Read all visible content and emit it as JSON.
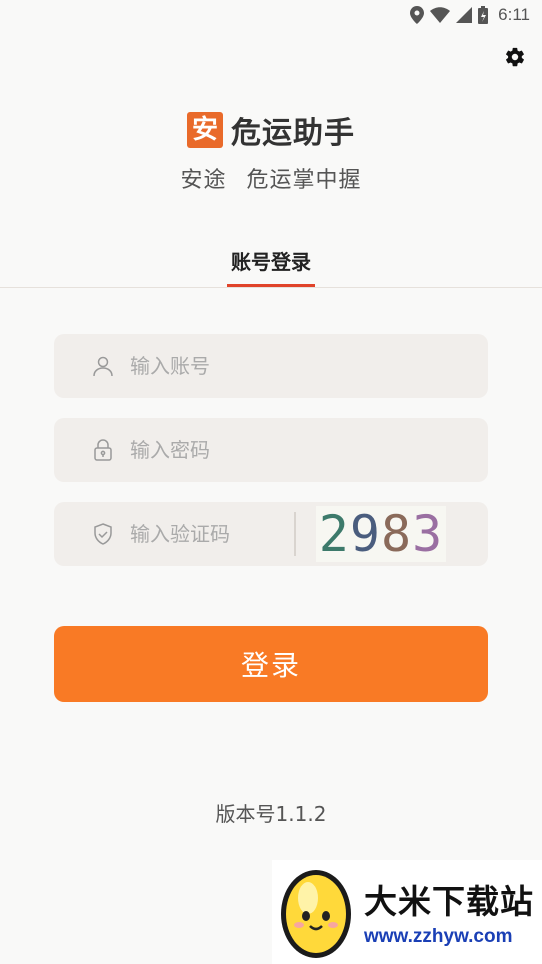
{
  "status_bar": {
    "time": "6:11",
    "icons": [
      "location-icon",
      "wifi-icon",
      "signal-icon",
      "battery-icon"
    ]
  },
  "header": {
    "settings_icon": "gear-icon",
    "logo_char": "安",
    "app_name": "危运助手",
    "slogan": "安途 危运掌中握"
  },
  "tabs": [
    {
      "label": "账号登录",
      "active": true
    }
  ],
  "form": {
    "account": {
      "placeholder": "输入账号",
      "value": "",
      "icon": "user-icon"
    },
    "password": {
      "placeholder": "输入密码",
      "value": "",
      "icon": "lock-icon"
    },
    "captcha": {
      "placeholder": "输入验证码",
      "value": "",
      "icon": "shield-icon",
      "code": "2983"
    },
    "login_label": "登录"
  },
  "footer": {
    "version": "版本号1.1.2"
  },
  "watermark": {
    "title": "大米下载站",
    "url": "www.zzhyw.com"
  },
  "colors": {
    "accent": "#f97a25",
    "tab_indicator": "#e0432a",
    "logo": "#e96a2a",
    "field_bg": "#f1eeeb",
    "background": "#f9f9f8"
  }
}
